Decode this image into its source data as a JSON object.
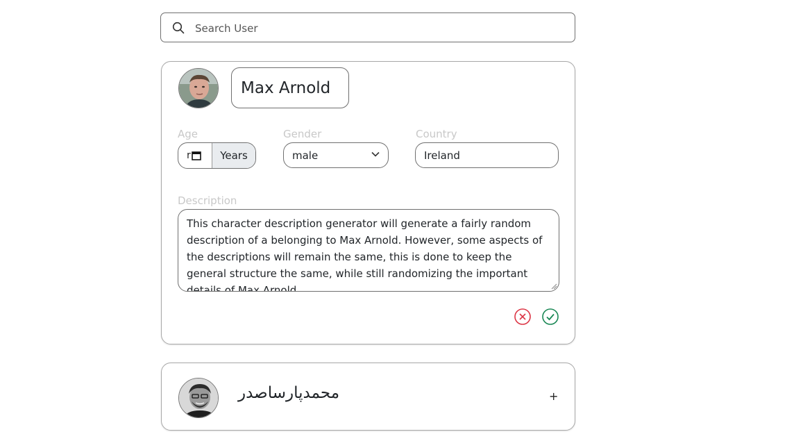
{
  "search": {
    "placeholder": "Search User",
    "icon": "search-icon"
  },
  "users": [
    {
      "name": "Max Arnold",
      "expanded": true,
      "age_value": "r",
      "age_unit": "Years",
      "gender": "male",
      "country": "Ireland",
      "labels": {
        "age": "Age",
        "gender": "Gender",
        "country": "Country",
        "description": "Description"
      },
      "description": "This character description generator will generate a fairly random description of a belonging to Max Arnold. However, some aspects of the descriptions will remain the same, this is done to keep the general structure the same, while still randomizing the important details of Max Arnold.",
      "actions": {
        "cancel_icon": "cancel-circle-icon",
        "confirm_icon": "check-circle-icon"
      }
    },
    {
      "name": "محمدپارساصدر",
      "expanded": false,
      "expand_label": "+"
    }
  ],
  "colors": {
    "cancel": "#dc3545",
    "confirm": "#198754",
    "label": "#c8c8c8",
    "border": "#6f6f6f"
  }
}
